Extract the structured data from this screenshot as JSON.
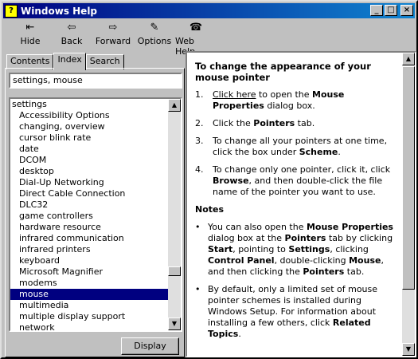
{
  "window": {
    "title": "Windows Help"
  },
  "titlebar_buttons": {
    "minimize": "_",
    "maximize": "□",
    "close": "×"
  },
  "toolbar": {
    "items": [
      {
        "label": "Hide",
        "icon": "hide-icon"
      },
      {
        "label": "Back",
        "icon": "back-arrow-icon"
      },
      {
        "label": "Forward",
        "icon": "forward-arrow-icon"
      },
      {
        "label": "Options",
        "icon": "options-icon"
      },
      {
        "label": "Web Help",
        "icon": "web-help-icon"
      }
    ]
  },
  "tabs": [
    {
      "label": "Contents"
    },
    {
      "label": "Index"
    },
    {
      "label": "Search"
    }
  ],
  "search": {
    "value": "settings, mouse"
  },
  "index_list": [
    "settings",
    "Accessibility Options",
    "changing, overview",
    "cursor blink rate",
    "date",
    "DCOM",
    "desktop",
    "Dial-Up Networking",
    "Direct Cable Connection",
    "DLC32",
    "game controllers",
    "hardware resource",
    "infrared communication",
    "infrared printers",
    "keyboard",
    "Microsoft Magnifier",
    "modems",
    "mouse",
    "multimedia",
    "multiple display support",
    "network"
  ],
  "selected_item": "mouse",
  "display_button": "Display",
  "topic": {
    "heading": "To change the appearance of your mouse pointer",
    "step1_link": "Click here",
    "step1_rest": " to open the ",
    "step1_bold": "Mouse Properties",
    "step1_end": " dialog box.",
    "step2_pre": "Click the ",
    "step2_bold": "Pointers",
    "step2_end": " tab.",
    "step3_pre": "To change all your pointers at one time, click the box under ",
    "step3_bold": "Scheme",
    "step3_end": ".",
    "step4_pre": "To change only one pointer, click it, click ",
    "step4_bold": "Browse",
    "step4_end": ", and then double-click the file name of the pointer you want to use.",
    "notes_heading": "Notes",
    "note1_a": "You can also open the ",
    "note1_b": "Mouse Properties",
    "note1_c": " dialog box at the ",
    "note1_d": "Pointers",
    "note1_e": " tab by clicking ",
    "note1_f": "Start",
    "note1_g": ", pointing to ",
    "note1_h": "Settings",
    "note1_i": ", clicking ",
    "note1_j": "Control Panel",
    "note1_k": ", double-clicking ",
    "note1_l": "Mouse",
    "note1_m": ", and then clicking the ",
    "note1_n": "Pointers",
    "note1_o": " tab.",
    "note2_a": "By default, only a limited set of mouse pointer schemes is installed during Windows Setup. For information about installing a few others, click ",
    "note2_b": "Related Topics",
    "note2_c": "."
  }
}
